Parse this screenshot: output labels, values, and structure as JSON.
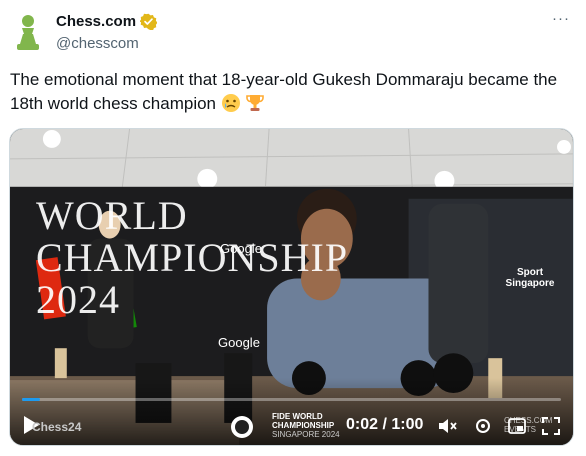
{
  "tweet": {
    "author_name": "Chess.com",
    "author_handle": "@chesscom",
    "more_label": "···",
    "text": "The emotional moment that 18-year-old Gukesh Dommaraju became the 18th world chess champion"
  },
  "icons": {
    "avatar": "chess-pawn-icon",
    "verified": "verified-badge-icon",
    "emoji_1": "crying-face-emoji",
    "emoji_2": "trophy-emoji"
  },
  "video": {
    "banner_text": "WORLD CHAMPIONSHIP 2024",
    "sponsor_1": "Google",
    "sponsor_2": "Sport Singapore",
    "brand_left": "Chess24",
    "fide_line1": "FIDE WORLD",
    "fide_line2": "CHAMPIONSHIP",
    "fide_line3": "SINGAPORE 2024",
    "current_time": "0:02",
    "duration": "1:00",
    "time_display": "0:02 / 1:00",
    "progress": 0.033,
    "watermark": "CHESS.COM EVENTS"
  },
  "colors": {
    "accent": "#1d9bf0",
    "verified_gold": "#e2b719",
    "pawn_green": "#81b64c"
  }
}
